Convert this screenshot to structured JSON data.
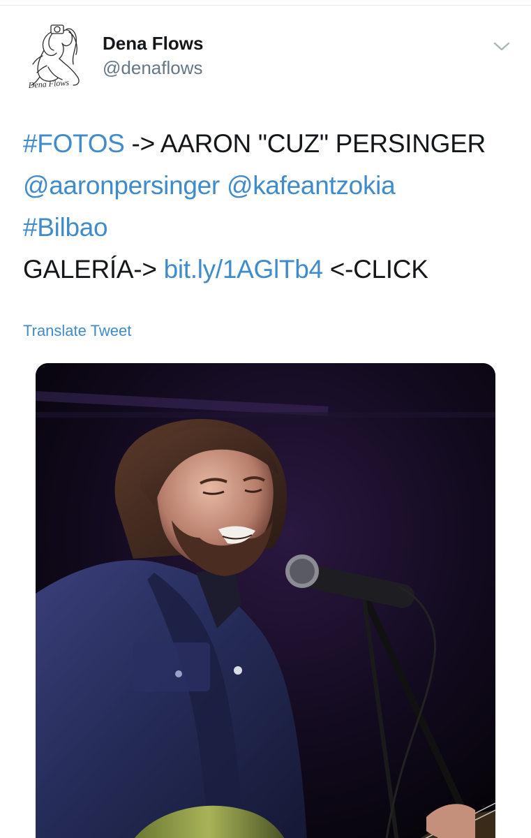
{
  "author": {
    "display_name": "Dena Flows",
    "handle": "@denaflows",
    "avatar_signature": "Dena Flows"
  },
  "tweet": {
    "hashtag_fotos": "#FOTOS",
    "text_arrow_title": " -> AARON \"CUZ\" PERSINGER",
    "mention_1": "@aaronpersinger",
    "mention_space": " ",
    "mention_2": "@kafeantzokia",
    "hashtag_bilbao": "#Bilbao",
    "gallery_prefix": "GALERÍA-> ",
    "gallery_link": "bit.ly/1AGlTb4",
    "gallery_suffix": " <-CLICK"
  },
  "translate_label": "Translate Tweet",
  "icons": {
    "menu": "chevron-down-icon",
    "avatar": "photographer-sketch-icon"
  },
  "colors": {
    "link": "#3f8bcb",
    "text": "#14171a",
    "secondary": "#657786",
    "divider": "#e1e8ed"
  }
}
